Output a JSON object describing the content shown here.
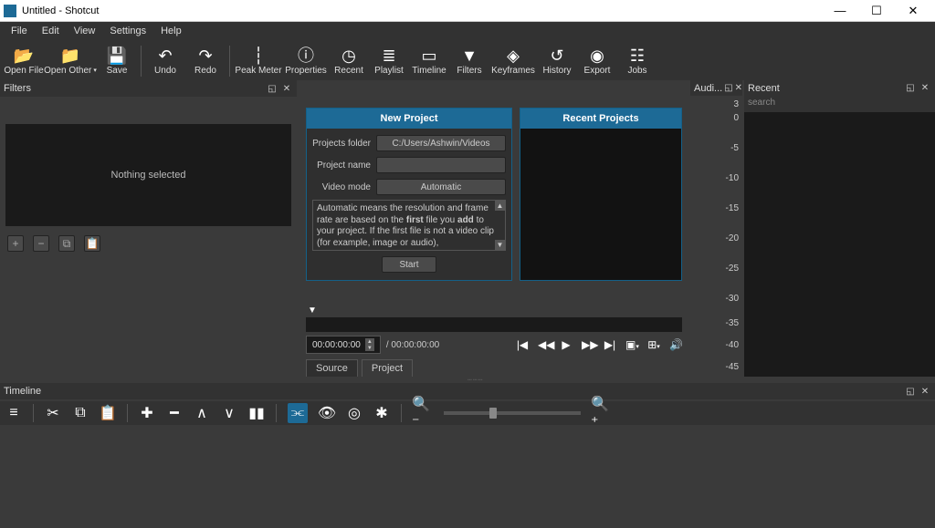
{
  "window": {
    "title": "Untitled - Shotcut"
  },
  "menu": {
    "file": "File",
    "edit": "Edit",
    "view": "View",
    "settings": "Settings",
    "help": "Help"
  },
  "toolbar": {
    "open_file": "Open File",
    "open_other": "Open Other",
    "save": "Save",
    "undo": "Undo",
    "redo": "Redo",
    "peak_meter": "Peak Meter",
    "properties": "Properties",
    "recent": "Recent",
    "playlist": "Playlist",
    "timeline": "Timeline",
    "filters": "Filters",
    "keyframes": "Keyframes",
    "history": "History",
    "export": "Export",
    "jobs": "Jobs"
  },
  "filters_panel": {
    "title": "Filters",
    "placeholder": "Nothing selected"
  },
  "new_project": {
    "title": "New Project",
    "folder_label": "Projects folder",
    "folder_value": "C:/Users/Ashwin/Videos",
    "name_label": "Project name",
    "name_value": "",
    "mode_label": "Video mode",
    "mode_value": "Automatic",
    "desc_pre": "Automatic means the resolution and frame rate are based on the ",
    "desc_bold1": "first",
    "desc_mid": " file you ",
    "desc_bold2": "add",
    "desc_post": " to your project. If the first file is not a video clip (for example, image or audio),",
    "start": "Start"
  },
  "recent_projects": {
    "title": "Recent Projects"
  },
  "player": {
    "timecode": "00:00:00:00",
    "total": "/ 00:00:00:00",
    "tab_source": "Source",
    "tab_project": "Project"
  },
  "audio_panel": {
    "title": "Audi...",
    "ticks": [
      "3",
      "0",
      "-5",
      "-10",
      "-15",
      "-20",
      "-25",
      "-30",
      "-35",
      "-40",
      "-45"
    ]
  },
  "recent_panel": {
    "title": "Recent",
    "search_placeholder": "search"
  },
  "timeline_panel": {
    "title": "Timeline"
  }
}
